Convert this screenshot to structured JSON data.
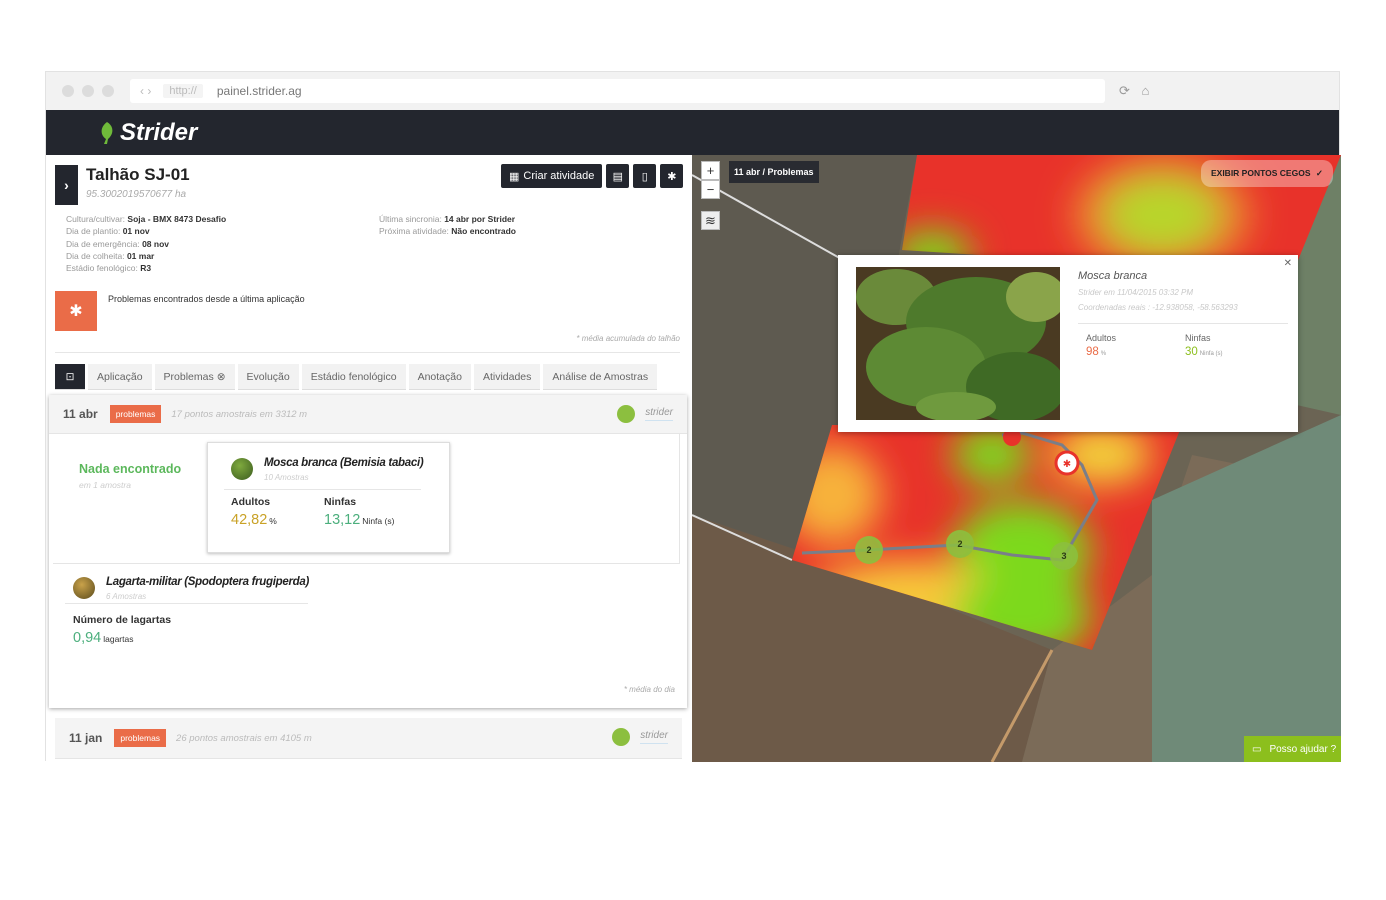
{
  "browser": {
    "url_protocol": "http://",
    "url_domain": "painel.strider.ag"
  },
  "app": {
    "logo_text": "Strider",
    "brand_color": "#23262e",
    "accent_color": "#ea6c48"
  },
  "field": {
    "title": "Talhão SJ-01",
    "area": "95.3002019570677 ha",
    "info_left": [
      {
        "label": "Cultura/cultivar: ",
        "value": "Soja - BMX 8473 Desafio"
      },
      {
        "label": "Dia de plantio: ",
        "value": "01 nov"
      },
      {
        "label": "Dia de emergência: ",
        "value": "08 nov"
      },
      {
        "label": "Dia de colheita: ",
        "value": "01 mar"
      },
      {
        "label": "Estádio fenológico: ",
        "value": "R3"
      }
    ],
    "info_right": [
      {
        "label": "Última sincronia: ",
        "value": "14 abr por Strider"
      },
      {
        "label": "Próxima atividade: ",
        "value": "Não encontrado"
      }
    ]
  },
  "toolbar": {
    "create_activity": "Criar atividade"
  },
  "alert": {
    "text": "Problemas encontrados desde a última aplicação",
    "note": "* média acumulada do talhão"
  },
  "tabs": [
    {
      "label": "Aplicação"
    },
    {
      "label": "Problemas"
    },
    {
      "label": "Evolução"
    },
    {
      "label": "Estádio fenológico"
    },
    {
      "label": "Anotação"
    },
    {
      "label": "Atividades"
    },
    {
      "label": "Análise de Amostras"
    }
  ],
  "records": [
    {
      "date": "11 abr",
      "badge": "problemas",
      "samples": "17 pontos amostrais em 3312 m",
      "user": "strider",
      "nothing_found": "Nada encontrado",
      "nothing_sub": "em 1 amostra",
      "pest1": {
        "name": "Mosca branca (Bemisia tabaci)",
        "samples": "10 Amostras",
        "m1_label": "Adultos",
        "m1_value": "42,82",
        "m1_unit": "%",
        "m1_color": "#c9a227",
        "m2_label": "Ninfas",
        "m2_value": "13,12",
        "m2_unit": "Ninfa (s)",
        "m2_color": "#4caf7d"
      },
      "pest2": {
        "name": "Lagarta-militar (Spodoptera frugiperda)",
        "samples": "6 Amostras",
        "m1_label": "Número de lagartas",
        "m1_value": "0,94",
        "m1_unit": "lagartas",
        "m1_color": "#4caf7d"
      },
      "note": "* média do dia"
    },
    {
      "date": "11 jan",
      "badge": "problemas",
      "samples": "26 pontos amostrais em 4105 m",
      "user": "strider"
    }
  ],
  "map": {
    "label": "11 abr / Problemas",
    "blind_spots_button": "EXIBIR PONTOS CEGOS",
    "zoom_in": "+",
    "zoom_out": "−",
    "clusters": [
      "2",
      "2",
      "3"
    ],
    "popup": {
      "title": "Mosca branca",
      "by": "Strider em 11/04/2015 03:32 PM",
      "coords": "Coordenadas reais : -12.938058, -58.563293",
      "m1_label": "Adultos",
      "m1_value": "98",
      "m1_unit": "%",
      "m1_color": "#ea6c48",
      "m2_label": "Ninfas",
      "m2_value": "30",
      "m2_unit": "Ninfa (s)",
      "m2_color": "#8cbf1d"
    },
    "help": "Posso ajudar ?"
  }
}
